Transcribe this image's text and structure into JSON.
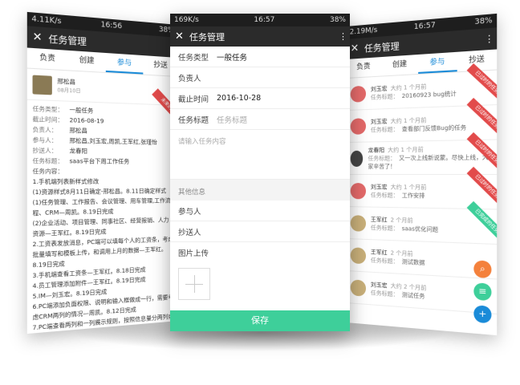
{
  "left": {
    "status_left": "4.11K/s",
    "status_time": "16:56",
    "status_right": "38%",
    "title": "任务管理",
    "tabs": [
      "负责",
      "创建",
      "参与",
      "抄送"
    ],
    "active_tab": 2,
    "creator": "邢松昌",
    "date": "08月10日",
    "fields": [
      [
        "任务类型：",
        "一般任务"
      ],
      [
        "截止时间：",
        "2016-08-19"
      ],
      [
        "负责人：",
        "邢松昌"
      ],
      [
        "参与人：",
        "邢松昌,刘玉宏,周凯,王军红,张瑾怡"
      ],
      [
        "抄送人：",
        "龙春阳"
      ],
      [
        "任务标题：",
        "saas平台下周工作任务"
      ]
    ],
    "content_label": "任务内容：",
    "paras": [
      "1.手机端列表新样式修改",
      "(1)资源样式8月11日确定-邢松昌。8.11日确定样式",
      "(1)任务管理、工作报告、会议管理、用车管理,工作流程、CRM—周凯。8.19日完成",
      "(2)企业活动、项目管理、同事社区、经营报销、人力资源—王军红。8.19日完成",
      "2.工资表发放消息，PC端可以填每个人的工资条，考虑批量填写和模板上传，和调用上月的数据—王军红。8.19日完成",
      "3.手机端查看工资条—王军红。8.18日完成",
      "4.员工管理添加附件—王军红。8.19日完成",
      "5.IM—刘玉宏。8.19日完成",
      "6.PC端添加负面权限、说明和输入框做成一行，需要考虑CRM两列的情况—周凯。8.12日完成",
      "7.PC端查看两列和一列展示规则，按照信息量分两列或一列展示—王军红。8.12日完成"
    ],
    "flag": "未来的任务"
  },
  "center": {
    "status_left": "169K/s",
    "status_time": "16:57",
    "status_right": "38%",
    "title": "任务管理",
    "type_label": "任务类型",
    "type_value": "一般任务",
    "owner_label": "负责人",
    "deadline_label": "截止时间",
    "deadline_value": "2016-10-28",
    "title_label": "任务标题",
    "title_placeholder": "任务标题",
    "content_placeholder": "请输入任务内容",
    "other_label": "其他信息",
    "participants_label": "参与人",
    "cc_label": "抄送人",
    "upload_label": "图片上传",
    "save_label": "保存"
  },
  "right": {
    "status_left": "2.19M/s",
    "status_time": "16:57",
    "status_right": "38%",
    "title": "任务管理",
    "tabs": [
      "负责",
      "创建",
      "参与",
      "抄送"
    ],
    "active_tab": 2,
    "items": [
      {
        "name": "刘玉宏",
        "ago": "大约 1 个月前",
        "label": "任务标题：",
        "subject": "20160923 bug统计",
        "flag": "已过时的任务",
        "flagColor": "#e24b4b"
      },
      {
        "name": "刘玉宏",
        "ago": "大约 1 个月前",
        "label": "任务标题：",
        "subject": "查看部门反馈Bug的任务",
        "flag": "已过时的任务",
        "flagColor": "#e24b4b"
      },
      {
        "name": "龙春阳",
        "ago": "大约 1 个月前",
        "label": "任务标题：",
        "subject": "又一次上线新说蒙。尽快上线，大家辛苦了！",
        "flag": "已过时的任务",
        "flagColor": "#e24b4b"
      },
      {
        "name": "刘玉宏",
        "ago": "大约 1 个月前",
        "label": "任务标题：",
        "subject": "工作安排",
        "flag": "已过时的任务",
        "flagColor": "#e24b4b"
      },
      {
        "name": "王军红",
        "ago": "2 个月前",
        "label": "任务标题：",
        "subject": "saas优化问题",
        "flag": "已完成的任务",
        "flagColor": "#3ecf9a"
      },
      {
        "name": "王军红",
        "ago": "2 个月前",
        "label": "任务标题：",
        "subject": "测试数据",
        "flag": "",
        "flagColor": ""
      },
      {
        "name": "刘玉宏",
        "ago": "大约 2 个月前",
        "label": "任务标题：",
        "subject": "测试任务",
        "flag": "",
        "flagColor": ""
      }
    ]
  }
}
